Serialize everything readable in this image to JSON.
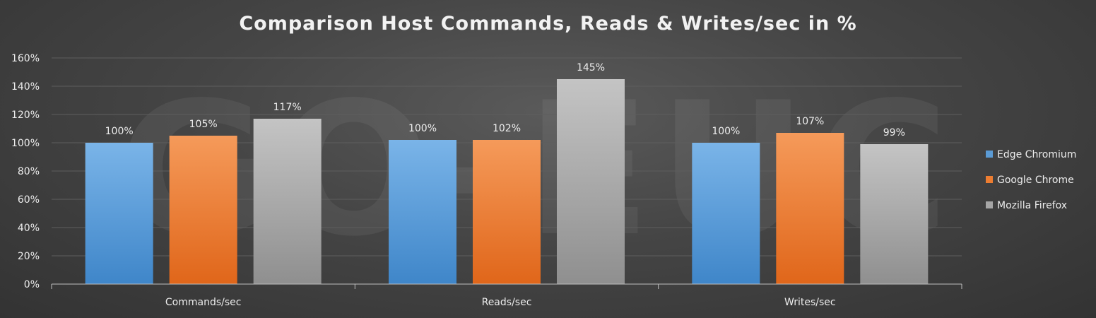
{
  "chart_data": {
    "type": "bar",
    "title": "Comparison Host Commands, Reads & Writes/sec in %",
    "xlabel": "",
    "ylabel": "",
    "categories": [
      "Commands/sec",
      "Reads/sec",
      "Writes/sec"
    ],
    "series": [
      {
        "name": "Edge Chromium",
        "values": [
          100,
          102,
          100
        ],
        "color": "#5b9bd5",
        "labels": [
          "100%",
          "100%",
          "100%"
        ]
      },
      {
        "name": "Google Chrome",
        "values": [
          105,
          102,
          107
        ],
        "color": "#ed7d31",
        "labels": [
          "105%",
          "102%",
          "107%"
        ]
      },
      {
        "name": "Mozilla Firefox",
        "values": [
          117,
          145,
          99
        ],
        "color": "#a5a5a5",
        "labels": [
          "117%",
          "145%",
          "99%"
        ]
      }
    ],
    "ylim": [
      0,
      160
    ],
    "yticks": [
      "0%",
      "20%",
      "40%",
      "60%",
      "80%",
      "100%",
      "120%",
      "140%",
      "160%"
    ],
    "grid": true,
    "legend_position": "right",
    "watermark": "GO-EUC"
  }
}
